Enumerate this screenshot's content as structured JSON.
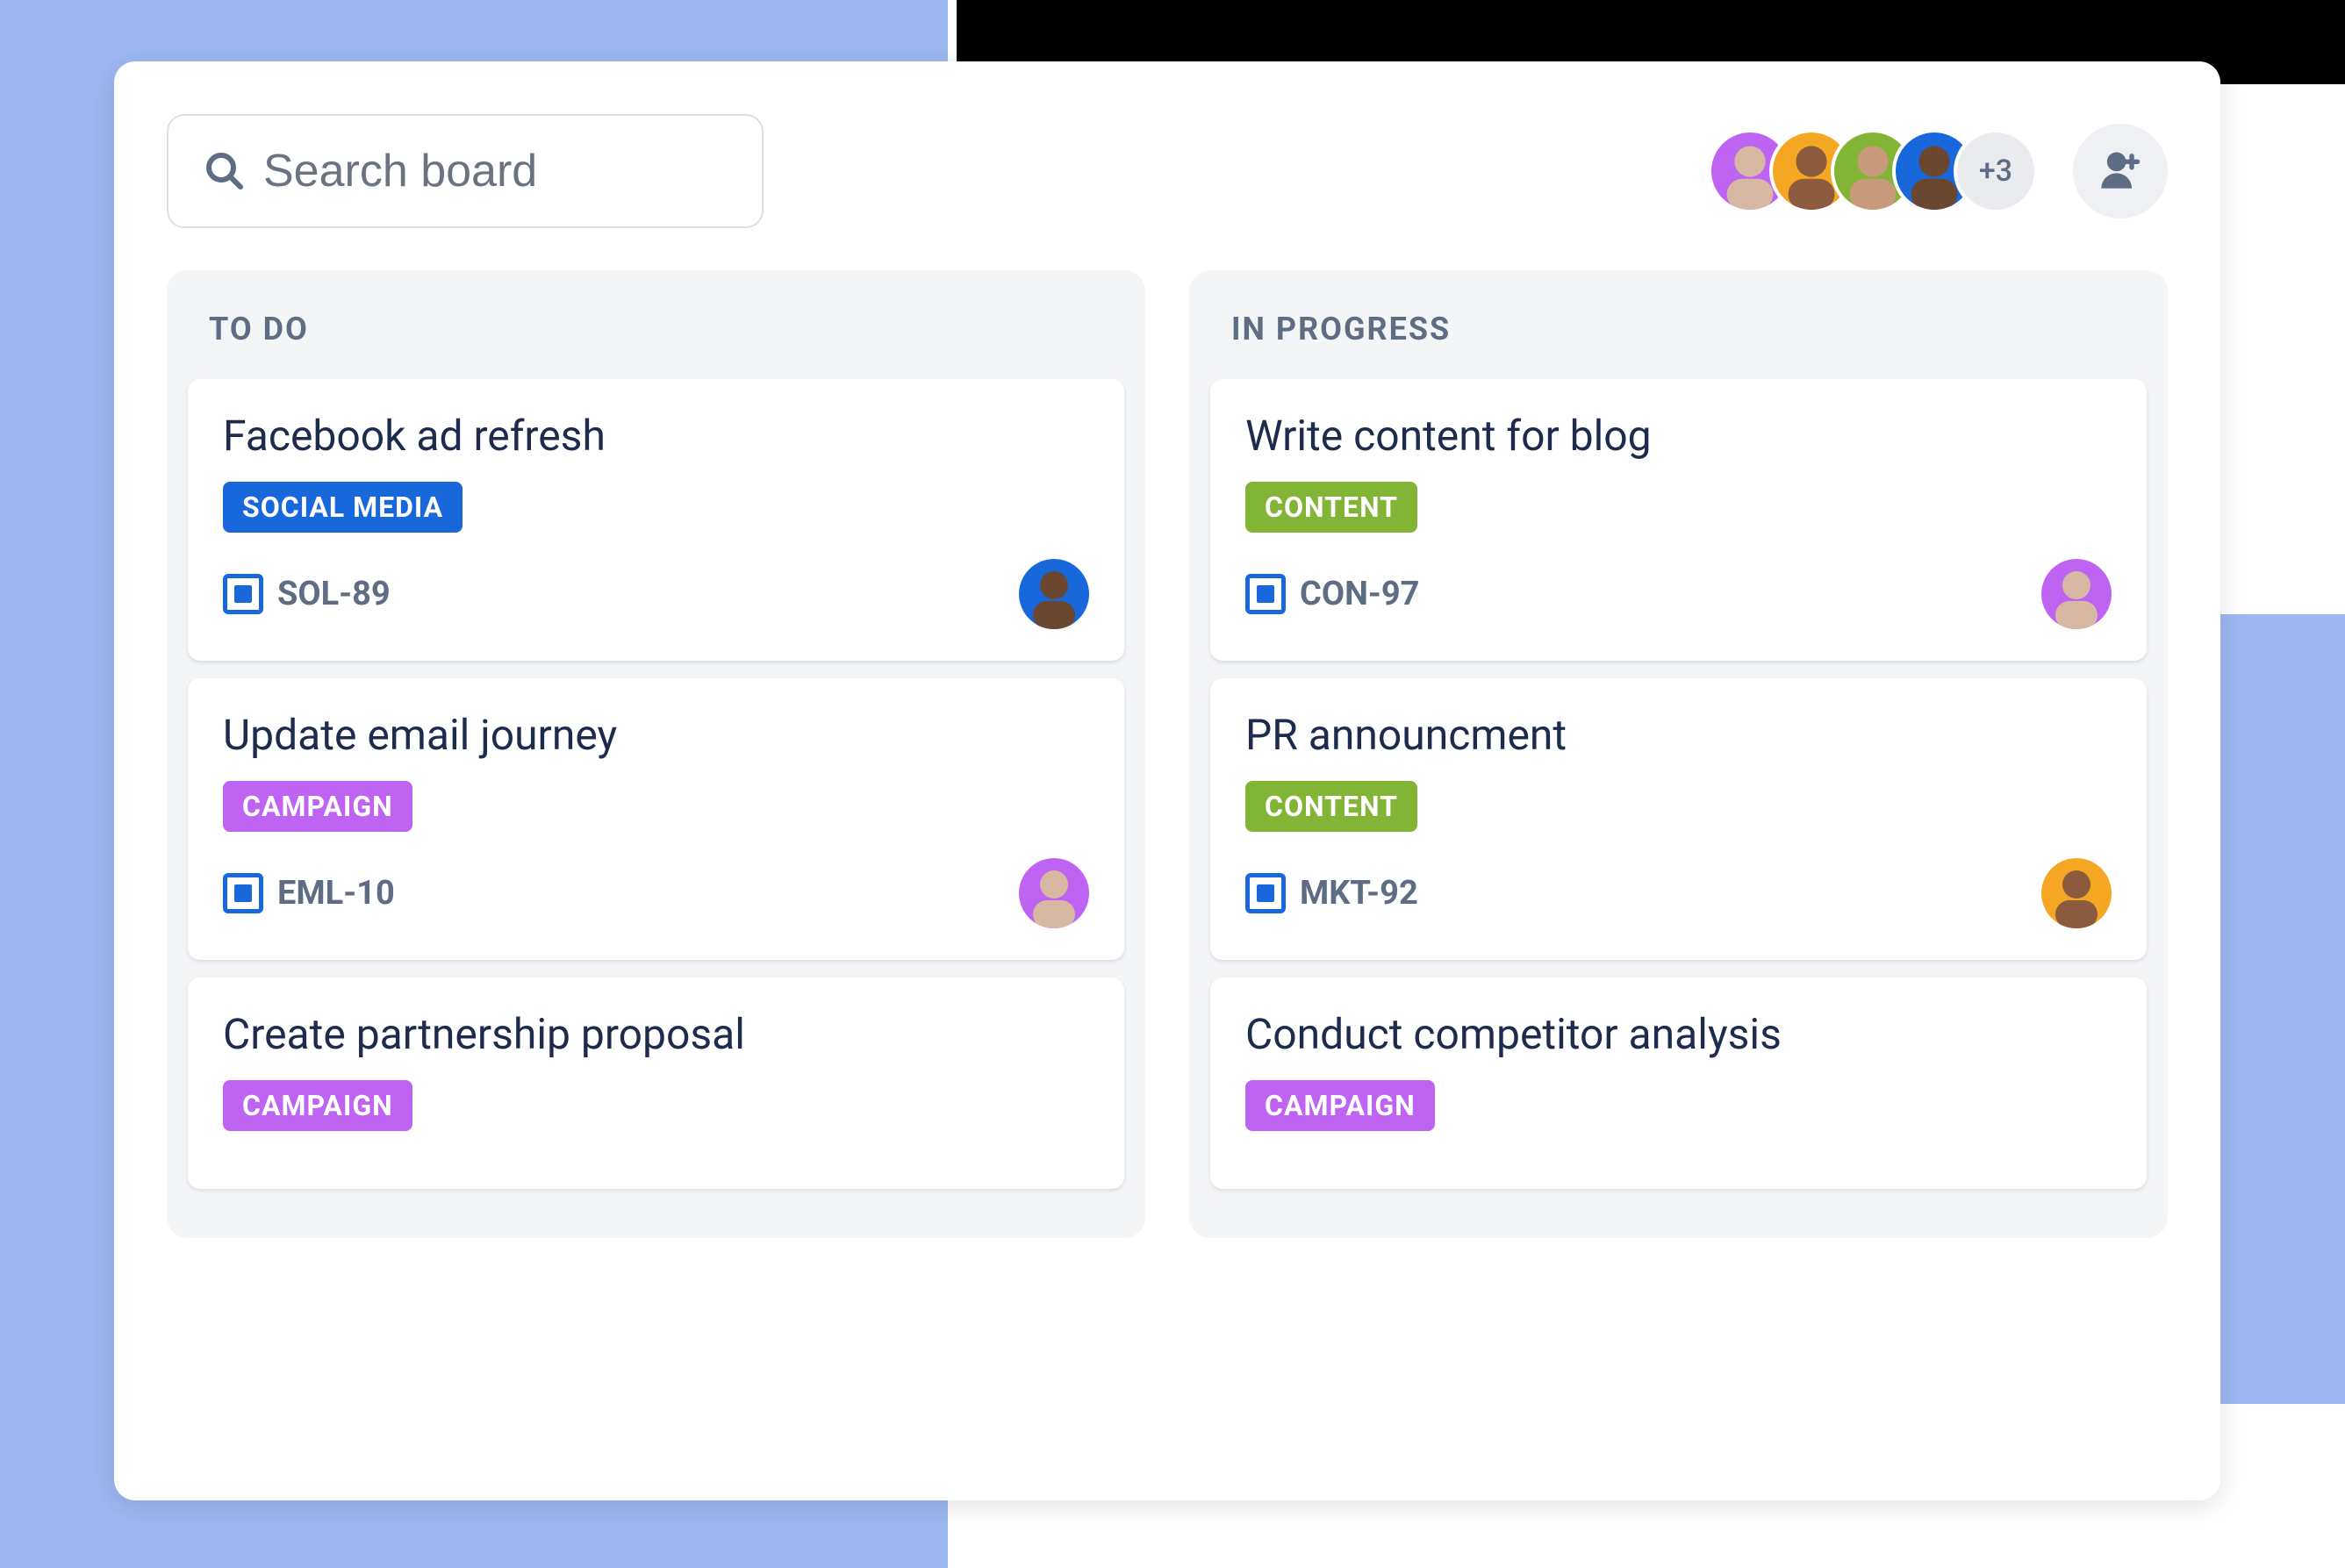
{
  "search": {
    "placeholder": "Search board"
  },
  "avatars": {
    "list": [
      {
        "bg": "#BF63F3"
      },
      {
        "bg": "#F5A623"
      },
      {
        "bg": "#82B536"
      },
      {
        "bg": "#1868DB"
      }
    ],
    "more_label": "+3"
  },
  "columns": [
    {
      "title": "TO DO",
      "cards": [
        {
          "title": "Facebook ad refresh",
          "tag": "SOCIAL MEDIA",
          "tag_class": "tag-social",
          "key": "SOL-89",
          "avatar_bg": "#1868DB"
        },
        {
          "title": "Update email journey",
          "tag": "CAMPAIGN",
          "tag_class": "tag-campaign",
          "key": "EML-10",
          "avatar_bg": "#BF63F3"
        },
        {
          "title": "Create partnership proposal",
          "tag": "CAMPAIGN",
          "tag_class": "tag-campaign",
          "key": "",
          "avatar_bg": ""
        }
      ]
    },
    {
      "title": "IN PROGRESS",
      "cards": [
        {
          "title": "Write content for blog",
          "tag": "CONTENT",
          "tag_class": "tag-content",
          "key": "CON-97",
          "avatar_bg": "#BF63F3"
        },
        {
          "title": "PR announcment",
          "tag": "CONTENT",
          "tag_class": "tag-content",
          "key": "MKT-92",
          "avatar_bg": "#F5A623"
        },
        {
          "title": "Conduct competitor analysis",
          "tag": "CAMPAIGN",
          "tag_class": "tag-campaign",
          "key": "",
          "avatar_bg": ""
        }
      ]
    }
  ]
}
